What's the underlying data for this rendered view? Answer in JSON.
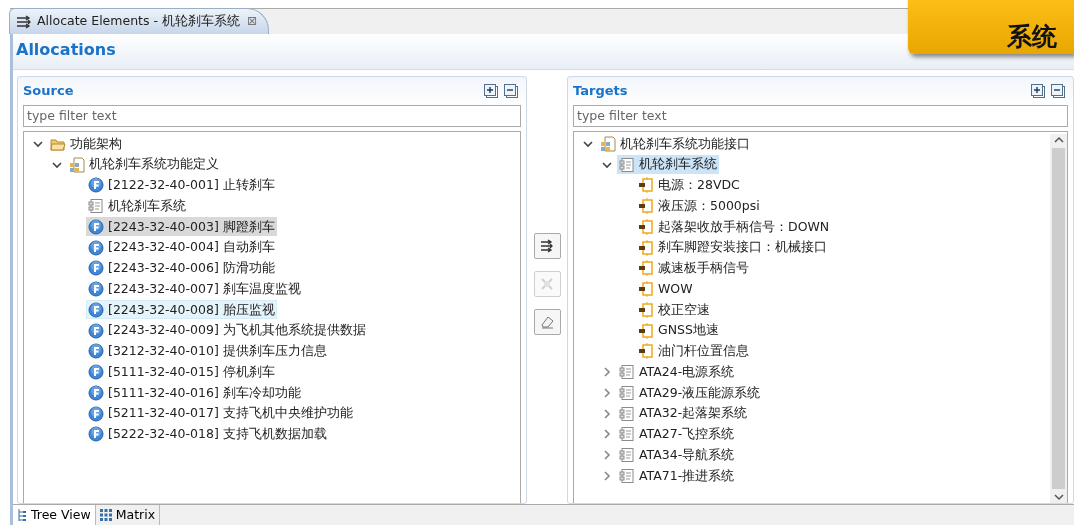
{
  "editor_tab": {
    "title": "Allocate Elements - 机轮刹车系统",
    "close": "⊠",
    "selected": true
  },
  "header": {
    "title": "Allocations"
  },
  "source": {
    "title": "Source",
    "filter": {
      "placeholder": "type filter text"
    },
    "tree": [
      {
        "label": "功能架构",
        "kind": "folder",
        "expanded": true,
        "selected": false,
        "hovered": false,
        "children": [
          {
            "label": "机轮刹车系统功能定义",
            "kind": "package",
            "expanded": true,
            "selected": false,
            "hovered": false,
            "children": [
              {
                "label": "[2122-32-40-001] 止转刹车",
                "kind": "function",
                "selected": false,
                "hovered": false
              },
              {
                "label": "机轮刹车系统",
                "kind": "component",
                "selected": false,
                "hovered": false
              },
              {
                "label": "[2243-32-40-003] 脚蹬刹车",
                "kind": "function",
                "selected": true,
                "hovered": false
              },
              {
                "label": "[2243-32-40-004] 自动刹车",
                "kind": "function",
                "selected": false,
                "hovered": false
              },
              {
                "label": "[2243-32-40-006] 防滑功能",
                "kind": "function",
                "selected": false,
                "hovered": false
              },
              {
                "label": "[2243-32-40-007] 刹车温度监视",
                "kind": "function",
                "selected": false,
                "hovered": false
              },
              {
                "label": "[2243-32-40-008] 胎压监视",
                "kind": "function",
                "selected": false,
                "hovered": true
              },
              {
                "label": "[2243-32-40-009] 为飞机其他系统提供数据",
                "kind": "function",
                "selected": false,
                "hovered": false
              },
              {
                "label": "[3212-32-40-010] 提供刹车压力信息",
                "kind": "function",
                "selected": false,
                "hovered": false
              },
              {
                "label": "[5111-32-40-015] 停机刹车",
                "kind": "function",
                "selected": false,
                "hovered": false
              },
              {
                "label": "[5111-32-40-016] 刹车冷却功能",
                "kind": "function",
                "selected": false,
                "hovered": false
              },
              {
                "label": "[5211-32-40-017] 支持飞机中央维护功能",
                "kind": "function",
                "selected": false,
                "hovered": false
              },
              {
                "label": "[5222-32-40-018] 支持飞机数据加载",
                "kind": "function",
                "selected": false,
                "hovered": false
              }
            ]
          }
        ]
      }
    ]
  },
  "actions": [
    {
      "kind": "allocate",
      "disabled": false
    },
    {
      "kind": "remove",
      "disabled": true
    },
    {
      "kind": "clear",
      "disabled": false
    }
  ],
  "targets": {
    "title": "Targets",
    "filter": {
      "placeholder": "type filter text"
    },
    "tree": [
      {
        "label": "机轮刹车系统功能接口",
        "kind": "package",
        "expanded": true,
        "selected": false,
        "hovered": false,
        "children": [
          {
            "label": "机轮刹车系统",
            "kind": "component",
            "expanded": true,
            "selected": true,
            "hovered": false,
            "children": [
              {
                "label": "电源：28VDC",
                "kind": "port",
                "selected": false,
                "hovered": false
              },
              {
                "label": "液压源：5000psi",
                "kind": "port",
                "selected": false,
                "hovered": false
              },
              {
                "label": "起落架收放手柄信号：DOWN",
                "kind": "port",
                "selected": false,
                "hovered": false
              },
              {
                "label": "刹车脚蹬安装接口：机械接口",
                "kind": "port",
                "selected": false,
                "hovered": false
              },
              {
                "label": "减速板手柄信号",
                "kind": "port",
                "selected": false,
                "hovered": false
              },
              {
                "label": "WOW",
                "kind": "port",
                "selected": false,
                "hovered": false
              },
              {
                "label": "校正空速",
                "kind": "port",
                "selected": false,
                "hovered": false
              },
              {
                "label": "GNSS地速",
                "kind": "port",
                "selected": false,
                "hovered": false
              },
              {
                "label": "油门杆位置信息",
                "kind": "port",
                "selected": false,
                "hovered": false
              }
            ]
          },
          {
            "label": "ATA24-电源系统",
            "kind": "component",
            "expanded": false,
            "selected": false,
            "hovered": false
          },
          {
            "label": "ATA29-液压能源系统",
            "kind": "component",
            "expanded": false,
            "selected": false,
            "hovered": false
          },
          {
            "label": "ATA32-起落架系统",
            "kind": "component",
            "expanded": false,
            "selected": false,
            "hovered": false
          },
          {
            "label": "ATA27-飞控系统",
            "kind": "component",
            "expanded": false,
            "selected": false,
            "hovered": false
          },
          {
            "label": "ATA34-导航系统",
            "kind": "component",
            "expanded": false,
            "selected": false,
            "hovered": false
          },
          {
            "label": "ATA71-推进系统",
            "kind": "component",
            "expanded": false,
            "selected": false,
            "hovered": false
          }
        ]
      }
    ]
  },
  "bottom_tabs": [
    {
      "label": "Tree View",
      "kind": "tree",
      "selected": true
    },
    {
      "label": "Matrix",
      "kind": "matrix",
      "selected": false
    }
  ],
  "callout": {
    "text": "系统"
  }
}
